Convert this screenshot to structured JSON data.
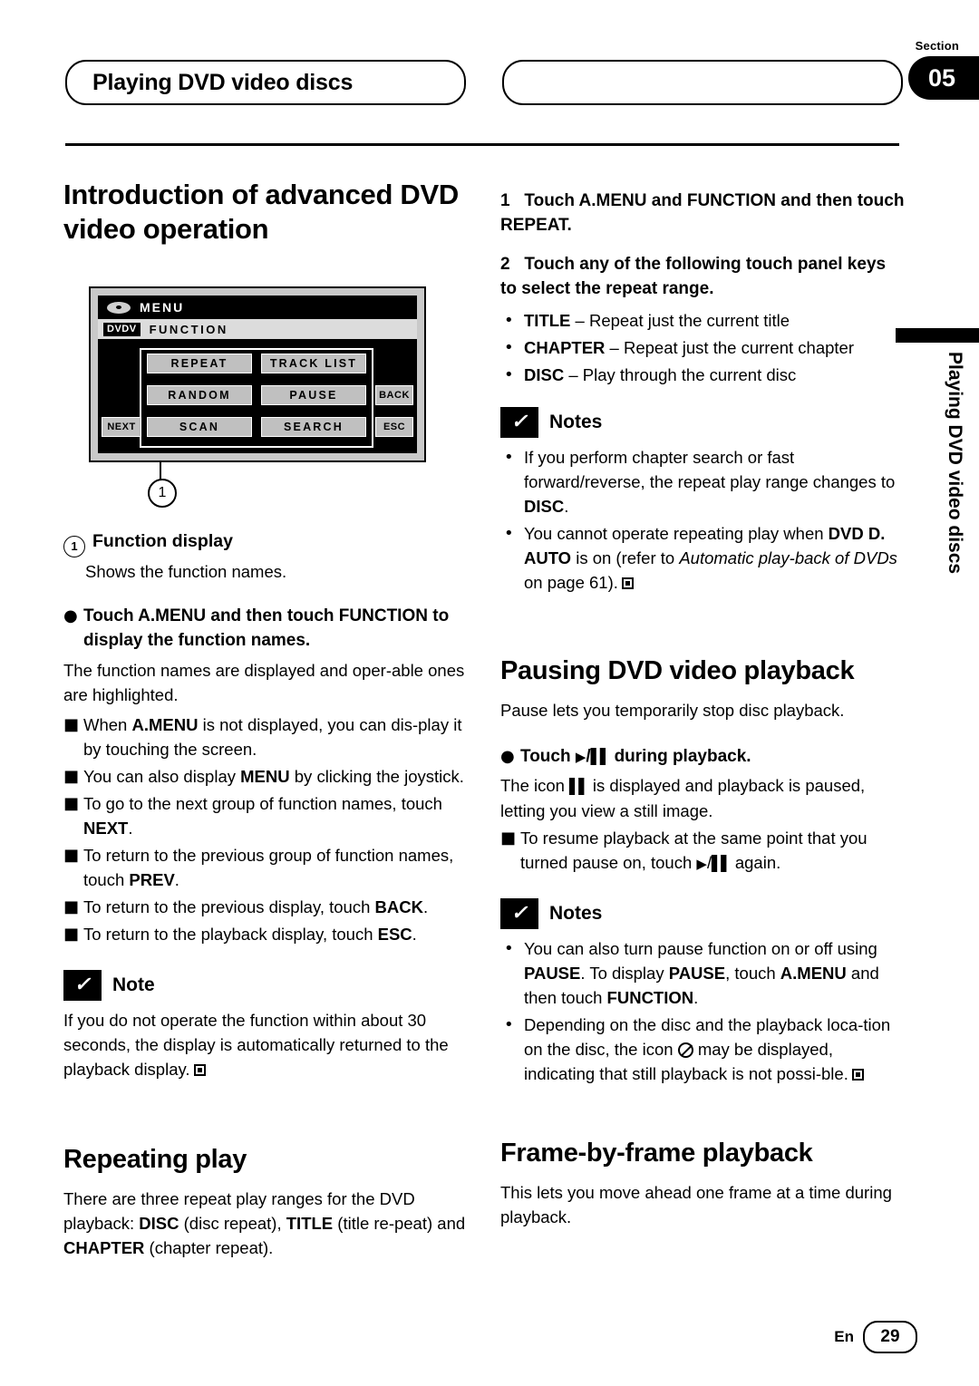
{
  "header": {
    "section_label": "Section",
    "section_number": "05",
    "title": "Playing DVD video discs",
    "side_tab_text": "Playing DVD video discs"
  },
  "left": {
    "heading": "Introduction of advanced DVD video operation",
    "device": {
      "menu_label": "MENU",
      "badge": "DVDV",
      "function_label": "FUNCTION",
      "keys": [
        "REPEAT",
        "TRACK LIST",
        "RANDOM",
        "PAUSE",
        "BACK",
        "NEXT",
        "SCAN",
        "SEARCH",
        "ESC"
      ],
      "callout_number": "1"
    },
    "callout_title": "Function display",
    "callout_desc": "Shows the function names.",
    "bullet_bold": "Touch A.MENU and then touch FUNCTION to display the function names.",
    "para1": "The function names are displayed and oper-able ones are highlighted.",
    "sub_items": [
      "When A.MENU is not displayed, you can dis-play it by touching the screen.",
      "You can also display MENU by clicking the joystick.",
      "To go to the next group of function names, touch NEXT.",
      "To return to the previous group of function names, touch PREV.",
      "To return to the previous display, touch BACK.",
      "To return to the playback display, touch ESC."
    ],
    "note_label": "Note",
    "note_text": "If you do not operate the function within about 30 seconds, the display is automatically returned to the playback display.",
    "repeat_heading": "Repeating play",
    "repeat_text": "There are three repeat play ranges for the DVD playback: DISC (disc repeat), TITLE (title re-peat) and CHAPTER (chapter repeat)."
  },
  "right": {
    "step1": "1   Touch A.MENU and FUNCTION and then touch REPEAT.",
    "step2": "2   Touch any of the following touch panel keys to select the repeat range.",
    "range_items": [
      {
        "key": "TITLE",
        "desc": "– Repeat just the current title"
      },
      {
        "key": "CHAPTER",
        "desc": "– Repeat just the current chapter"
      },
      {
        "key": "DISC",
        "desc": "– Play through the current disc"
      }
    ],
    "notes_label": "Notes",
    "notes": [
      "If you perform chapter search or fast forward/reverse, the repeat play range changes to DISC.",
      "You cannot operate repeating play when DVD D. AUTO is on (refer to Automatic play-back of DVDs on page 61)."
    ],
    "pausing_heading": "Pausing DVD video playback",
    "pausing_text": "Pause lets you temporarily stop disc playback.",
    "pausing_bullet": "Touch ▶/Ⅱ during playback.",
    "pausing_body": "The icon Ⅱ is displayed and playback is paused, letting you view a still image.",
    "pausing_sub": "To resume playback at the same point that you turned pause on, touch ▶/Ⅱ again.",
    "notes2_label": "Notes",
    "notes2": [
      "You can also turn pause function on or off using PAUSE. To display PAUSE, touch A.MENU and then touch FUNCTION.",
      "Depending on the disc and the playback loca-tion on the disc, the icon  may be displayed, indicating that still playback is not possi-ble."
    ],
    "frame_heading": "Frame-by-frame playback",
    "frame_text": "This lets you move ahead one frame at a time during playback."
  },
  "footer": {
    "lang": "En",
    "page": "29"
  }
}
